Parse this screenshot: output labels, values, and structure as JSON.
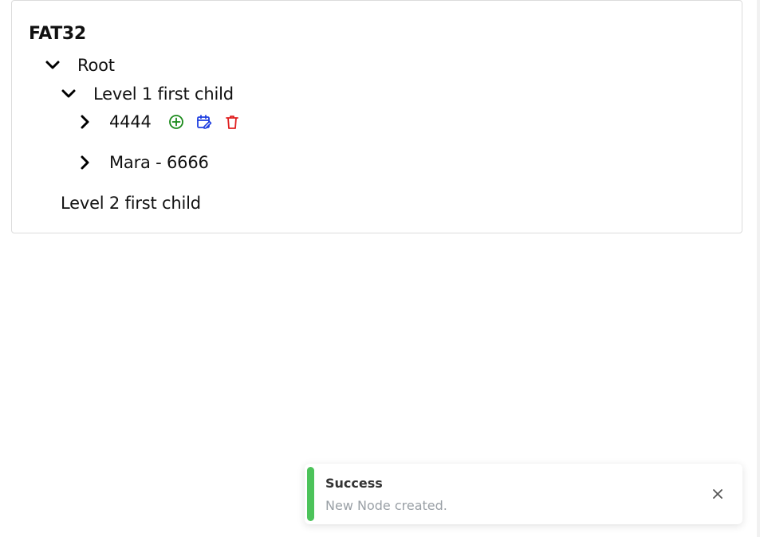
{
  "tree": {
    "title": "FAT32",
    "root_label": "Root",
    "level1_label": "Level 1 first child",
    "nodes": [
      {
        "label": "4444"
      },
      {
        "label": "Mara - 6666"
      }
    ],
    "level2_label": "Level 2 first child"
  },
  "icons": {
    "expanded": "chevron-down-icon",
    "collapsed": "chevron-right-icon",
    "add": "plus-circle-icon",
    "edit": "calendar-edit-icon",
    "delete": "trash-icon",
    "close": "close-icon"
  },
  "colors": {
    "add": "#1a8a1a",
    "edit": "#1f3fe0",
    "delete": "#e02020",
    "success": "#4cc35a"
  },
  "toast": {
    "title": "Success",
    "message": "New Node created."
  }
}
